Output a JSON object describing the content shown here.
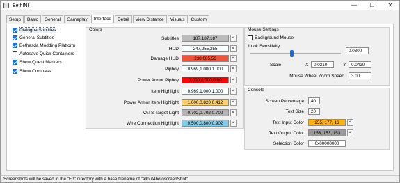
{
  "window": {
    "title": "BethINI",
    "minimize": "—",
    "maximize": "☐",
    "close": "✕"
  },
  "tabs": [
    "Setup",
    "Basic",
    "General",
    "Gameplay",
    "Interface",
    "Detail",
    "View Distance",
    "Visuals",
    "Custom"
  ],
  "active_tab": "Interface",
  "options": [
    {
      "label": "Dialogue Subtitles",
      "checked": true
    },
    {
      "label": "General Subtitles",
      "checked": true
    },
    {
      "label": "Bethesda Modding Platform",
      "checked": true
    },
    {
      "label": "Autosave Quick Containers",
      "checked": false
    },
    {
      "label": "Show Quest Markers",
      "checked": true
    },
    {
      "label": "Show Compass",
      "checked": true
    }
  ],
  "colors": {
    "title": "Colors",
    "rows": [
      {
        "label": "Subtitles",
        "value": "187,187,187",
        "bg": "#bbbbbb",
        "fg": "#000000"
      },
      {
        "label": "HUD",
        "value": "247,255,255",
        "bg": "#f7ffff",
        "fg": "#000000"
      },
      {
        "label": "Damage HUD",
        "value": "238,085,56",
        "bg": "#ee5538",
        "fg": "#000000"
      },
      {
        "label": "Pipboy",
        "value": "0.969,1.000,1.000",
        "bg": "#f7ffff",
        "fg": "#000000"
      },
      {
        "label": "Power Armor Pipboy",
        "value": "1.000,0.000,0.00",
        "bg": "#ff0000",
        "fg": "#000000"
      },
      {
        "label": "Item Highlight",
        "value": "0.969,1.000,1.000",
        "bg": "#f7ffff",
        "fg": "#000000"
      },
      {
        "label": "Power Armor Item Highlight",
        "value": "1.000,0.820,0.412",
        "bg": "#ffd169",
        "fg": "#000000"
      },
      {
        "label": "VATS Target Light",
        "value": "0.702,0.702,0.702",
        "bg": "#b3b3b3",
        "fg": "#000000"
      },
      {
        "label": "Wire Connection Highlight",
        "value": "0.500,0.800,0.902",
        "bg": "#80cce6",
        "fg": "#000000"
      }
    ],
    "picker_label": "<"
  },
  "mouse": {
    "title": "Mouse Settings",
    "background_mouse": {
      "label": "Background Mouse",
      "checked": false
    },
    "look_sensitivity": {
      "label": "Look Sensitivity",
      "value": "0.0300",
      "level": 0.45
    },
    "scale": {
      "label": "Scale",
      "x_label": "X",
      "x_value": "0.0210",
      "y_label": "Y",
      "y_value": "0.0420"
    },
    "zoom_speed": {
      "label": "Mouse Wheel Zoom Speed",
      "value": "3.00"
    }
  },
  "console": {
    "title": "Console",
    "screen_percentage": {
      "label": "Screen Percentage",
      "value": "40"
    },
    "text_size": {
      "label": "Text Size",
      "value": "20"
    },
    "text_input_color": {
      "label": "Text Input Color",
      "value": "255, 177, 16",
      "bg": "#ffb110"
    },
    "text_output_color": {
      "label": "Text Output Color",
      "value": "153, 153, 153",
      "bg": "#999999"
    },
    "selection_color": {
      "label": "Selection Color",
      "value": "0x00000000"
    }
  },
  "status": "Screenshots will be saved in the \"E:\\\" directory with a base filename of \"allout4hotoscreenShot\""
}
